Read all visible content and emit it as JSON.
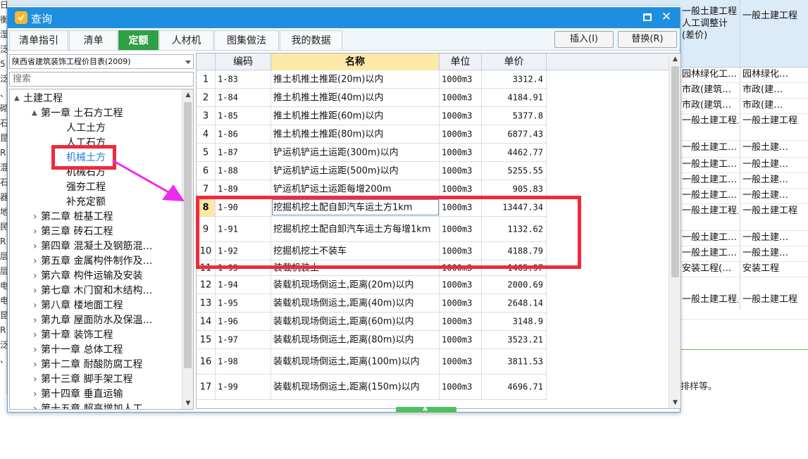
{
  "window": {
    "title": "查询"
  },
  "tabs": [
    {
      "label": "清单指引"
    },
    {
      "label": "清单"
    },
    {
      "label": "定额"
    },
    {
      "label": "人材机"
    },
    {
      "label": "图集做法"
    },
    {
      "label": "我的数据"
    }
  ],
  "toolbar": {
    "insert_label": "插入(I)",
    "replace_label": "替换(R)"
  },
  "library": {
    "selected": "陕西省建筑装饰工程价目表(2009)"
  },
  "search": {
    "placeholder": "搜索"
  },
  "tree": {
    "root": "土建工程",
    "chapter1": "第一章 土石方工程",
    "chapter1_items": [
      "人工土方",
      "人工石方",
      "机械土方",
      "机械石方",
      "强夯工程",
      "补充定额"
    ],
    "chapters": [
      "第二章 桩基工程",
      "第三章 砖石工程",
      "第四章 混凝土及钢筋混…",
      "第五章 金属构件制作及…",
      "第六章 构件运输及安装",
      "第七章 木门窗和木结构…",
      "第八章 楼地面工程",
      "第九章 屋面防水及保温…",
      "第十章 装饰工程",
      "第十一章 总体工程",
      "第十二章 耐酸防腐工程",
      "第十三章 脚手架工程",
      "第十四章 垂直运输",
      "第十五章 超高增加人工…"
    ]
  },
  "grid": {
    "headers": {
      "code": "编码",
      "name": "名称",
      "unit": "单位",
      "price": "单价"
    },
    "rows": [
      {
        "n": "1",
        "code": "1-83",
        "name": "推土机推土推距(20m)以内",
        "unit": "1000m3",
        "price": "3312.4"
      },
      {
        "n": "2",
        "code": "1-84",
        "name": "推土机推土推距(40m)以内",
        "unit": "1000m3",
        "price": "4184.91"
      },
      {
        "n": "3",
        "code": "1-85",
        "name": "推土机推土推距(60m)以内",
        "unit": "1000m3",
        "price": "5377.8"
      },
      {
        "n": "4",
        "code": "1-86",
        "name": "推土机推土推距(80m)以内",
        "unit": "1000m3",
        "price": "6877.43"
      },
      {
        "n": "5",
        "code": "1-87",
        "name": "铲运机铲运土运距(300m)以内",
        "unit": "1000m3",
        "price": "4462.77"
      },
      {
        "n": "6",
        "code": "1-88",
        "name": "铲运机铲运土运距(500m)以内",
        "unit": "1000m3",
        "price": "5255.55"
      },
      {
        "n": "7",
        "code": "1-89",
        "name": "铲运机铲运土运距每增200m",
        "unit": "1000m3",
        "price": "905.83"
      },
      {
        "n": "8",
        "code": "1-90",
        "name": "挖掘机挖土配自卸汽车运土方1km",
        "unit": "1000m3",
        "price": "13447.34"
      },
      {
        "n": "9",
        "code": "1-91",
        "name": "挖掘机挖土配自卸汽车运土方每增1km",
        "unit": "1000m3",
        "price": "1132.62"
      },
      {
        "n": "10",
        "code": "1-92",
        "name": "挖掘机挖土不装车",
        "unit": "1000m3",
        "price": "4188.79"
      },
      {
        "n": "11",
        "code": "1-93",
        "name": "装载机装土",
        "unit": "1000m3",
        "price": "1465.97"
      },
      {
        "n": "12",
        "code": "1-94",
        "name": "装载机现场倒运土,距离(20m)以内",
        "unit": "1000m3",
        "price": "2000.69"
      },
      {
        "n": "13",
        "code": "1-95",
        "name": "装载机现场倒运土,距离(40m)以内",
        "unit": "1000m3",
        "price": "2648.14"
      },
      {
        "n": "14",
        "code": "1-96",
        "name": "装载机现场倒运土,距离(60m)以内",
        "unit": "1000m3",
        "price": "3148.9"
      },
      {
        "n": "15",
        "code": "1-97",
        "name": "装载机现场倒运土,距离(80m)以内",
        "unit": "1000m3",
        "price": "3523.21"
      },
      {
        "n": "16",
        "code": "1-98",
        "name": "装载机现场倒运土,距离(100m)以内",
        "unit": "1000m3",
        "price": "3811.53"
      },
      {
        "n": "17",
        "code": "1-99",
        "name": "装载机现场倒运土,距离(150m)以内",
        "unit": "1000m3",
        "price": "4696.71"
      }
    ]
  },
  "background": {
    "header_col1": "一般土建工程人工调整计(差价)",
    "header_col2": "一般土建工程",
    "rows": [
      {
        "a": "园林绿化工…",
        "b": "园林绿化…"
      },
      {
        "a": "市政(建筑…",
        "b": "市政(建…"
      },
      {
        "a": "市政(建筑…",
        "b": "市政(建…"
      },
      {
        "a": "一般土建工程人工调整…",
        "b": "一般土建工程"
      },
      {
        "a": "一般土建工…",
        "b": "一般土建…"
      },
      {
        "a": "一般土建工…",
        "b": "一般土建…"
      },
      {
        "a": "一般土建工…",
        "b": "一般土建…"
      },
      {
        "a": "一般土建工…",
        "b": "一般土建…"
      },
      {
        "a": "一般土建工程人工调整…",
        "b": "一般土建工程"
      },
      {
        "a": "一般土建工…",
        "b": "一般土建…"
      },
      {
        "a": "一般土建工…",
        "b": "一般土建…"
      },
      {
        "a": "安装工程(…",
        "b": "安装工程"
      },
      {
        "a": "一般土建工程人工调整…",
        "b": "一般土建工程"
      }
    ],
    "bottom_text": "排样等。",
    "left_frags": [
      "日待证",
      "衡",
      "湿",
      "泛",
      "5",
      "泛",
      "、",
      "砌",
      "石",
      "昆",
      "R",
      "混",
      "石",
      "器",
      "地",
      "民",
      "R",
      "层",
      "层",
      "电",
      "电",
      "昆",
      "R",
      "泛",
      "、"
    ]
  },
  "colors": {
    "title_bar": "#1e8fe0",
    "active_tab": "#2fa043",
    "annotation": "#f02a3c",
    "arrow": "#ee2bee"
  }
}
